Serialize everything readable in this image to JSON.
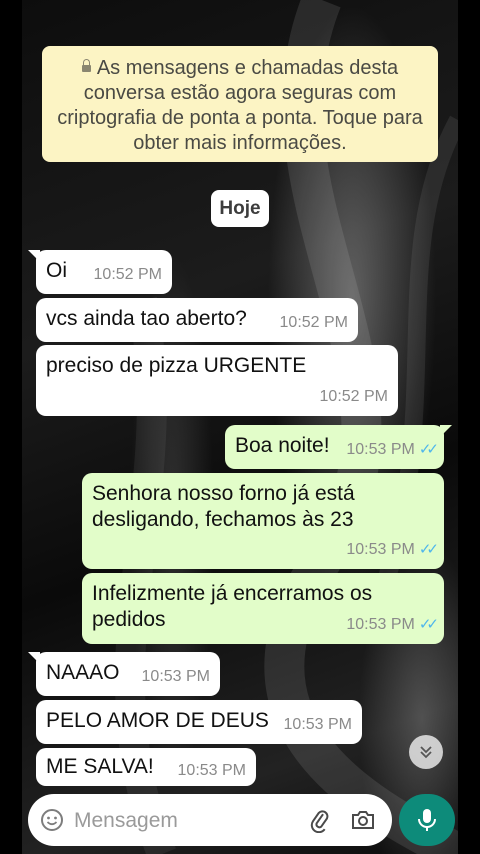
{
  "encryption_notice": "As mensagens e chamadas desta conversa estão agora seguras com criptografia de ponta a ponta. Toque para obter mais informações.",
  "date_chip": "Hoje",
  "messages": [
    {
      "text": "Oi",
      "time": "10:52 PM"
    },
    {
      "text": "vcs ainda tao aberto?",
      "time": "10:52 PM"
    },
    {
      "text": "preciso de pizza URGENTE",
      "time": "10:52 PM"
    },
    {
      "text": "Boa noite!",
      "time": "10:53 PM"
    },
    {
      "text": "Senhora nosso forno já está desligando, fechamos às 23",
      "time": "10:53 PM"
    },
    {
      "text": "Infelizmente já encerramos os pedidos",
      "time": "10:53 PM"
    },
    {
      "text": "NAAAO",
      "time": "10:53 PM"
    },
    {
      "text": "PELO AMOR DE DEUS",
      "time": "10:53 PM"
    },
    {
      "text": "ME SALVA!",
      "time": "10:53 PM"
    }
  ],
  "composer": {
    "placeholder": "Mensagem"
  },
  "icons": {
    "lock": "lock-icon",
    "read_receipt": "double-check-icon",
    "scroll_down": "double-chevron-down-icon",
    "emoji": "emoji-icon",
    "attach": "paperclip-icon",
    "camera": "camera-icon",
    "mic": "microphone-icon"
  },
  "colors": {
    "incoming_bubble": "#ffffff",
    "outgoing_bubble": "#e2fdc9",
    "notice_bg": "#fcf4c4",
    "read_ticks": "#4fb6ec",
    "mic_button": "#0d8b7a"
  }
}
